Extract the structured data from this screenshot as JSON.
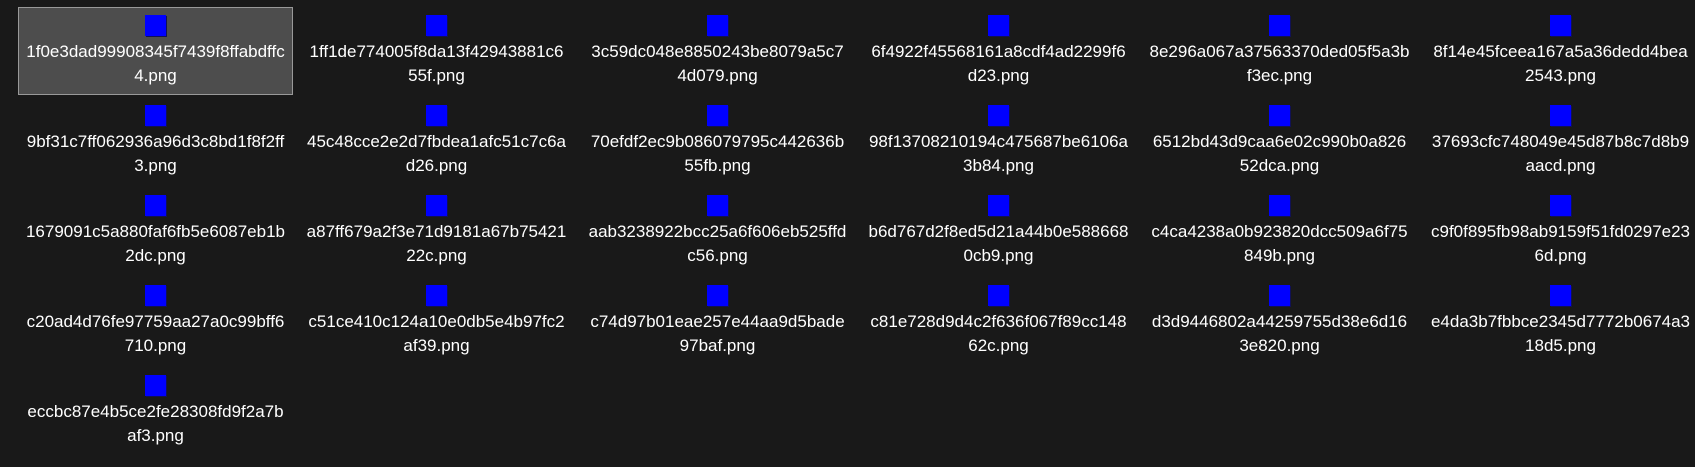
{
  "colors": {
    "background": "#191919",
    "selection_background": "#4d4d4d",
    "selection_border": "#999999",
    "thumbnail": "#0000ff",
    "text": "#ffffff"
  },
  "icon": "blue-square-thumbnail-icon",
  "files": [
    {
      "name": "1f0e3dad99908345f7439f8ffabdffc4.png",
      "selected": true
    },
    {
      "name": "1ff1de774005f8da13f42943881c655f.png"
    },
    {
      "name": "3c59dc048e8850243be8079a5c74d079.png"
    },
    {
      "name": "6f4922f45568161a8cdf4ad2299f6d23.png"
    },
    {
      "name": "8e296a067a37563370ded05f5a3bf3ec.png"
    },
    {
      "name": "8f14e45fceea167a5a36dedd4bea2543.png"
    },
    {
      "name": "9bf31c7ff062936a96d3c8bd1f8f2ff3.png"
    },
    {
      "name": "45c48cce2e2d7fbdea1afc51c7c6ad26.png"
    },
    {
      "name": "70efdf2ec9b086079795c442636b55fb.png"
    },
    {
      "name": "98f13708210194c475687be6106a3b84.png"
    },
    {
      "name": "6512bd43d9caa6e02c990b0a82652dca.png"
    },
    {
      "name": "37693cfc748049e45d87b8c7d8b9aacd.png"
    },
    {
      "name": "1679091c5a880faf6fb5e6087eb1b2dc.png"
    },
    {
      "name": "a87ff679a2f3e71d9181a67b7542122c.png"
    },
    {
      "name": "aab3238922bcc25a6f606eb525ffdc56.png"
    },
    {
      "name": "b6d767d2f8ed5d21a44b0e5886680cb9.png"
    },
    {
      "name": "c4ca4238a0b923820dcc509a6f75849b.png"
    },
    {
      "name": "c9f0f895fb98ab9159f51fd0297e236d.png"
    },
    {
      "name": "c20ad4d76fe97759aa27a0c99bff6710.png"
    },
    {
      "name": "c51ce410c124a10e0db5e4b97fc2af39.png"
    },
    {
      "name": "c74d97b01eae257e44aa9d5bade97baf.png"
    },
    {
      "name": "c81e728d9d4c2f636f067f89cc14862c.png"
    },
    {
      "name": "d3d9446802a44259755d38e6d163e820.png"
    },
    {
      "name": "e4da3b7fbbce2345d7772b0674a318d5.png"
    },
    {
      "name": "eccbc87e4b5ce2fe28308fd9f2a7baf3.png"
    }
  ]
}
